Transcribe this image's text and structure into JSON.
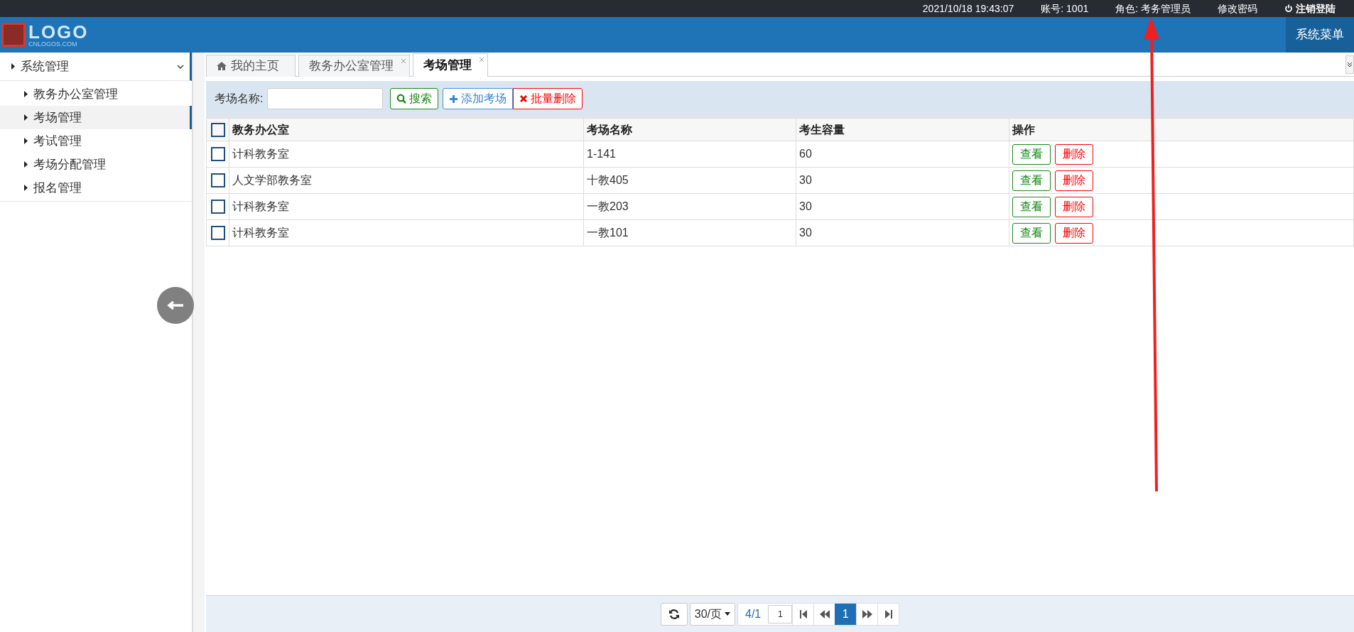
{
  "top_bar": {
    "datetime": "2021/10/18 19:43:07",
    "account": "账号: 1001",
    "role": "角色: 考务管理员",
    "change_password": "修改密码",
    "logout": "注销登陆"
  },
  "header": {
    "logo_text": "LOGO",
    "logo_sub": "CNLOGOS.COM",
    "menu_button": "系统菜单"
  },
  "sidebar": {
    "items": [
      {
        "label": "系统管理",
        "expanded": true,
        "selected": false,
        "children": [
          {
            "label": "教务办公室管理",
            "selected": false
          },
          {
            "label": "考场管理",
            "selected": true
          },
          {
            "label": "考试管理",
            "selected": false
          },
          {
            "label": "考场分配管理",
            "selected": false
          },
          {
            "label": "报名管理",
            "selected": false
          }
        ]
      }
    ]
  },
  "tabs": [
    {
      "label": "我的主页",
      "kind": "home",
      "selected": false
    },
    {
      "label": "教务办公室管理",
      "kind": "closable",
      "selected": false
    },
    {
      "label": "考场管理",
      "kind": "closable",
      "selected": true
    }
  ],
  "toolbar": {
    "field_label": "考场名称:",
    "search_button": "搜索",
    "add_button": "添加考场",
    "batch_delete_button": "批量删除"
  },
  "table": {
    "all_checked": false,
    "columns": [
      "教务办公室",
      "考场名称",
      "考生容量",
      "操作"
    ],
    "rows": [
      {
        "office": "计科教务室",
        "room": "1-141",
        "capacity": "60",
        "checked": false,
        "actions": [
          "查看",
          "删除"
        ]
      },
      {
        "office": "人文学部教务室",
        "room": "十教405",
        "capacity": "30",
        "checked": false,
        "actions": [
          "查看",
          "删除"
        ]
      },
      {
        "office": "计科教务室",
        "room": "一教203",
        "capacity": "30",
        "checked": false,
        "actions": [
          "查看",
          "删除"
        ]
      },
      {
        "office": "计科教务室",
        "room": "一教101",
        "capacity": "30",
        "checked": false,
        "actions": [
          "查看",
          "删除"
        ]
      }
    ]
  },
  "pagination": {
    "page_size": "30/页",
    "page_info": "4/1",
    "page_input": "1",
    "current_page": "1"
  }
}
